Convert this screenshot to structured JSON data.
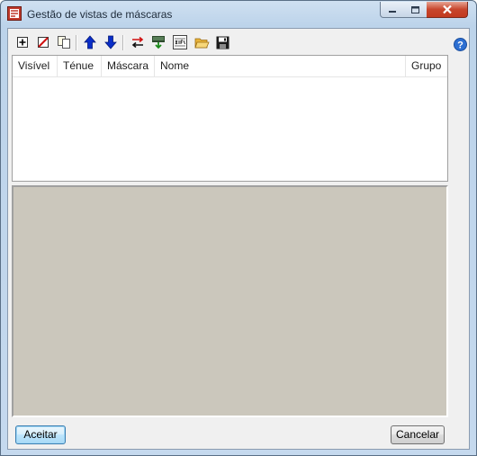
{
  "window": {
    "title": "Gestão de vistas de máscaras",
    "controls": [
      "minimize",
      "maximize",
      "close"
    ]
  },
  "toolbar": {
    "buttons": [
      {
        "icon": "add-icon"
      },
      {
        "icon": "delete-icon"
      },
      {
        "icon": "copy-icon"
      },
      {
        "icon": "arrow-up-icon"
      },
      {
        "icon": "arrow-down-icon"
      },
      {
        "icon": "swap-icon"
      },
      {
        "icon": "export-icon"
      },
      {
        "icon": "dxf-icon"
      },
      {
        "icon": "open-folder-icon"
      },
      {
        "icon": "save-icon"
      }
    ],
    "help_icon": "help-icon"
  },
  "list": {
    "columns": [
      "Visível",
      "Ténue",
      "Máscara",
      "Nome",
      "Grupo"
    ],
    "rows": []
  },
  "preview": {
    "background": "#cbc7bc"
  },
  "footer": {
    "accept_label": "Aceitar",
    "cancel_label": "Cancelar"
  }
}
